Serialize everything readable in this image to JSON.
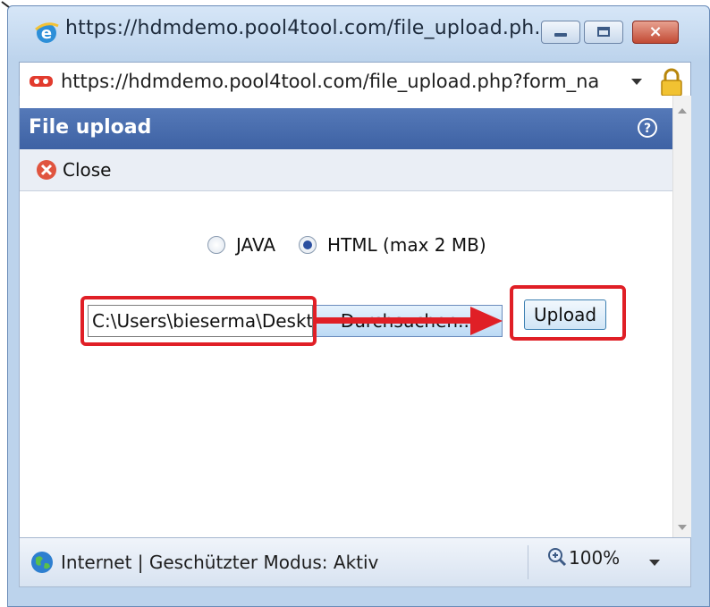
{
  "window": {
    "title": "https://hdmdemo.pool4tool.com/file_upload.ph...",
    "close_symbol": "×"
  },
  "address_bar": {
    "url": "https://hdmdemo.pool4tool.com/file_upload.php?form_na"
  },
  "panel": {
    "title": "File upload",
    "close_label": "Close"
  },
  "upload_mode": {
    "options": [
      {
        "label": "JAVA",
        "selected": false
      },
      {
        "label": "HTML (max 2 MB)",
        "selected": true
      }
    ]
  },
  "file_input": {
    "value": "C:\\Users\\bieserma\\Deskt",
    "browse_label": "Durchsuchen..."
  },
  "upload_label": "Upload",
  "status_bar": {
    "zone_text": "Internet | Geschützter Modus: Aktiv",
    "zoom": "100%"
  },
  "icons": {
    "title": "ie-icon",
    "address": "site-icon",
    "lock": "lock-icon",
    "help": "help-icon",
    "close_tool": "close-icon",
    "status": "globe-icon",
    "zoom": "zoom-icon"
  },
  "colors": {
    "panel_header": "#3e62a4",
    "highlight": "#e01f26"
  }
}
